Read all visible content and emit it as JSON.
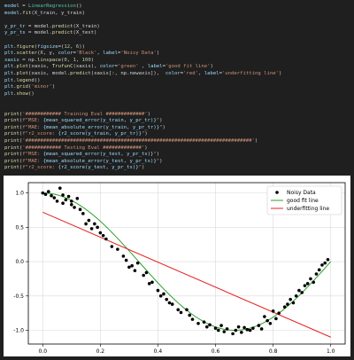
{
  "code_lines": [
    [
      [
        "model",
        "var"
      ],
      [
        " = ",
        "def"
      ],
      [
        "LinearRegression",
        "cls"
      ],
      [
        "()",
        "def"
      ]
    ],
    [
      [
        "model",
        "var"
      ],
      [
        ".",
        "def"
      ],
      [
        "fit",
        "fn"
      ],
      [
        "(X_train, y_train)",
        "def"
      ]
    ],
    [],
    [
      [
        "y_pr_tr",
        "var"
      ],
      [
        " = model.",
        "def"
      ],
      [
        "predict",
        "fn"
      ],
      [
        "(X_train)",
        "def"
      ]
    ],
    [
      [
        "y_pr_ts",
        "var"
      ],
      [
        " = model.",
        "def"
      ],
      [
        "predict",
        "fn"
      ],
      [
        "(X_test)",
        "def"
      ]
    ],
    [],
    [
      [
        "plt",
        "var"
      ],
      [
        ".",
        "def"
      ],
      [
        "figure",
        "fn"
      ],
      [
        "(",
        "def"
      ],
      [
        "figsize",
        "var"
      ],
      [
        "=(",
        "def"
      ],
      [
        "12",
        "num"
      ],
      [
        ", ",
        "def"
      ],
      [
        "6",
        "num"
      ],
      [
        "))",
        "def"
      ]
    ],
    [
      [
        "plt",
        "var"
      ],
      [
        ".",
        "def"
      ],
      [
        "scatter",
        "fn"
      ],
      [
        "(X, y, ",
        "def"
      ],
      [
        "color",
        "var"
      ],
      [
        "=",
        "def"
      ],
      [
        "'Black'",
        "str"
      ],
      [
        ", ",
        "def"
      ],
      [
        "label",
        "var"
      ],
      [
        "=",
        "def"
      ],
      [
        "'Noisy Data'",
        "str"
      ],
      [
        ")",
        "def"
      ]
    ],
    [
      [
        "xaxis",
        "var"
      ],
      [
        " = np.",
        "def"
      ],
      [
        "linspace",
        "fn"
      ],
      [
        "(",
        "def"
      ],
      [
        "0",
        "num"
      ],
      [
        ", ",
        "def"
      ],
      [
        "1",
        "num"
      ],
      [
        ", ",
        "def"
      ],
      [
        "100",
        "num"
      ],
      [
        ")",
        "def"
      ]
    ],
    [
      [
        "plt",
        "var"
      ],
      [
        ".",
        "def"
      ],
      [
        "plot",
        "fn"
      ],
      [
        "(xaxis, ",
        "def"
      ],
      [
        "TrufunC",
        "fn"
      ],
      [
        "(xaxis), ",
        "def"
      ],
      [
        "color",
        "var"
      ],
      [
        "=",
        "def"
      ],
      [
        "'green'",
        "str"
      ],
      [
        " , ",
        "def"
      ],
      [
        "label",
        "var"
      ],
      [
        "=",
        "def"
      ],
      [
        "'good fit line'",
        "str"
      ],
      [
        ")",
        "def"
      ]
    ],
    [
      [
        "plt",
        "var"
      ],
      [
        ".",
        "def"
      ],
      [
        "plot",
        "fn"
      ],
      [
        "(xaxis, model.",
        "def"
      ],
      [
        "predict",
        "fn"
      ],
      [
        "(xaxis[:, np.newaxis]),  ",
        "def"
      ],
      [
        "color",
        "var"
      ],
      [
        "=",
        "def"
      ],
      [
        "'red'",
        "str"
      ],
      [
        ", ",
        "def"
      ],
      [
        "label",
        "var"
      ],
      [
        "=",
        "def"
      ],
      [
        "'underfitting line'",
        "str"
      ],
      [
        ")",
        "def"
      ]
    ],
    [
      [
        "plt",
        "var"
      ],
      [
        ".",
        "def"
      ],
      [
        "legend",
        "fn"
      ],
      [
        "()",
        "def"
      ]
    ],
    [
      [
        "plt",
        "var"
      ],
      [
        ".",
        "def"
      ],
      [
        "grid",
        "fn"
      ],
      [
        "(",
        "def"
      ],
      [
        "'minor'",
        "str"
      ],
      [
        ")",
        "def"
      ]
    ],
    [
      [
        "plt",
        "var"
      ],
      [
        ".",
        "def"
      ],
      [
        "show",
        "fn"
      ],
      [
        "()",
        "def"
      ]
    ],
    [],
    [],
    [
      [
        "print",
        "fn"
      ],
      [
        "(",
        "def"
      ],
      [
        "'############ Training Eval #############'",
        "str"
      ],
      [
        ")",
        "def"
      ]
    ],
    [
      [
        "print",
        "fn"
      ],
      [
        "(",
        "def"
      ],
      [
        "f\"MSE: ",
        "str"
      ],
      [
        "{mean_squared_error(y_train, y_pr_tr)}",
        "var"
      ],
      [
        "\"",
        "str"
      ],
      [
        ")",
        "def"
      ]
    ],
    [
      [
        "print",
        "fn"
      ],
      [
        "(",
        "def"
      ],
      [
        "f\"MAE: ",
        "str"
      ],
      [
        "{mean_absolute_error(y_train, y_pr_tr)}",
        "var"
      ],
      [
        "\"",
        "str"
      ],
      [
        ")",
        "def"
      ]
    ],
    [
      [
        "print",
        "fn"
      ],
      [
        "(",
        "def"
      ],
      [
        "f\"r2_score: ",
        "str"
      ],
      [
        "{r2_score(y_train, y_pr_tr)}",
        "var"
      ],
      [
        "\"",
        "str"
      ],
      [
        ")",
        "def"
      ]
    ],
    [
      [
        "print",
        "fn"
      ],
      [
        "(",
        "def"
      ],
      [
        "'############################################################################'",
        "str"
      ],
      [
        ")",
        "def"
      ]
    ],
    [
      [
        "print",
        "fn"
      ],
      [
        "(",
        "def"
      ],
      [
        "'############ Testing Eval #############'",
        "str"
      ],
      [
        ")",
        "def"
      ]
    ],
    [
      [
        "print",
        "fn"
      ],
      [
        "(",
        "def"
      ],
      [
        "f\"MSE: ",
        "str"
      ],
      [
        "{mean_squared_error(y_test, y_pr_ts)}",
        "var"
      ],
      [
        "\"",
        "str"
      ],
      [
        ")",
        "def"
      ]
    ],
    [
      [
        "print",
        "fn"
      ],
      [
        "(",
        "def"
      ],
      [
        "f\"MAE: ",
        "str"
      ],
      [
        "{mean_absolute_error(y_test, y_pr_ts)}",
        "var"
      ],
      [
        "\"",
        "str"
      ],
      [
        ")",
        "def"
      ]
    ],
    [
      [
        "print",
        "fn"
      ],
      [
        "(",
        "def"
      ],
      [
        "f\"r2_score: ",
        "str"
      ],
      [
        "{r2_score(y_test, y_pr_ts)}",
        "var"
      ],
      [
        "\"",
        "str"
      ],
      [
        ")",
        "def"
      ]
    ]
  ],
  "token_colors": {
    "var": "#9cdcfe",
    "fn": "#dcdcaa",
    "str": "#ce9178",
    "num": "#b5cea8",
    "cls": "#4ec9b0",
    "def": "#d4d4d4"
  },
  "chart_data": {
    "type": "scatter",
    "title": "",
    "xlabel": "",
    "ylabel": "",
    "xlim": [
      -0.05,
      1.05
    ],
    "ylim": [
      -1.2,
      1.15
    ],
    "xticks": [
      0.0,
      0.2,
      0.4,
      0.6,
      0.8,
      1.0
    ],
    "xtick_labels": [
      "0.0",
      "0.2",
      "0.4",
      "0.6",
      "0.8",
      "1.0"
    ],
    "yticks": [
      -1.0,
      -0.5,
      0.0,
      0.5,
      1.0
    ],
    "ytick_labels": [
      "-1.0",
      "-0.5",
      "0.0",
      "0.5",
      "1.0"
    ],
    "grid": true,
    "legend_position": "top-right",
    "series": [
      {
        "name": "Noisy Data",
        "kind": "scatter",
        "color": "#000000",
        "x": [
          0.0,
          0.01,
          0.02,
          0.03,
          0.04,
          0.05,
          0.06,
          0.07,
          0.07,
          0.08,
          0.09,
          0.1,
          0.1,
          0.11,
          0.12,
          0.13,
          0.14,
          0.15,
          0.16,
          0.17,
          0.18,
          0.19,
          0.2,
          0.21,
          0.22,
          0.24,
          0.26,
          0.28,
          0.29,
          0.3,
          0.31,
          0.32,
          0.33,
          0.35,
          0.36,
          0.37,
          0.38,
          0.4,
          0.41,
          0.42,
          0.43,
          0.44,
          0.45,
          0.47,
          0.48,
          0.5,
          0.51,
          0.52,
          0.54,
          0.56,
          0.57,
          0.58,
          0.6,
          0.61,
          0.62,
          0.63,
          0.64,
          0.66,
          0.67,
          0.68,
          0.69,
          0.7,
          0.71,
          0.72,
          0.73,
          0.75,
          0.76,
          0.77,
          0.78,
          0.79,
          0.8,
          0.81,
          0.82,
          0.84,
          0.85,
          0.86,
          0.87,
          0.88,
          0.89,
          0.9,
          0.91,
          0.92,
          0.93,
          0.94,
          0.95,
          0.96,
          0.97,
          0.98,
          0.99
        ],
        "y": [
          1.0,
          0.98,
          1.02,
          0.96,
          0.93,
          0.88,
          1.07,
          0.97,
          0.85,
          0.9,
          0.95,
          0.88,
          0.83,
          0.79,
          0.92,
          0.76,
          0.7,
          0.55,
          0.6,
          0.48,
          0.55,
          0.5,
          0.42,
          0.38,
          0.33,
          0.22,
          0.18,
          0.08,
          0.02,
          -0.08,
          -0.06,
          -0.13,
          -0.02,
          -0.2,
          -0.16,
          -0.32,
          -0.3,
          -0.42,
          -0.5,
          -0.47,
          -0.55,
          -0.6,
          -0.62,
          -0.7,
          -0.74,
          -0.7,
          -0.78,
          -0.84,
          -0.9,
          -0.88,
          -0.95,
          -0.92,
          -0.97,
          -1.0,
          -0.93,
          -1.02,
          -0.98,
          -1.05,
          -1.0,
          -0.95,
          -1.03,
          -0.96,
          -0.99,
          -1.0,
          -0.97,
          -0.93,
          -0.98,
          -0.8,
          -0.86,
          -0.9,
          -0.72,
          -0.83,
          -0.75,
          -0.66,
          -0.62,
          -0.55,
          -0.6,
          -0.5,
          -0.42,
          -0.45,
          -0.35,
          -0.32,
          -0.25,
          -0.3,
          -0.18,
          -0.12,
          -0.05,
          -0.02,
          0.03
        ]
      },
      {
        "name": "good fit line",
        "kind": "line",
        "color": "#2ca02c",
        "function": "cos(1.5*pi*x)"
      },
      {
        "name": "underfitting line",
        "kind": "line",
        "color": "#e8211f",
        "x": [
          0.0,
          1.0
        ],
        "y": [
          0.72,
          -1.1
        ]
      }
    ]
  }
}
